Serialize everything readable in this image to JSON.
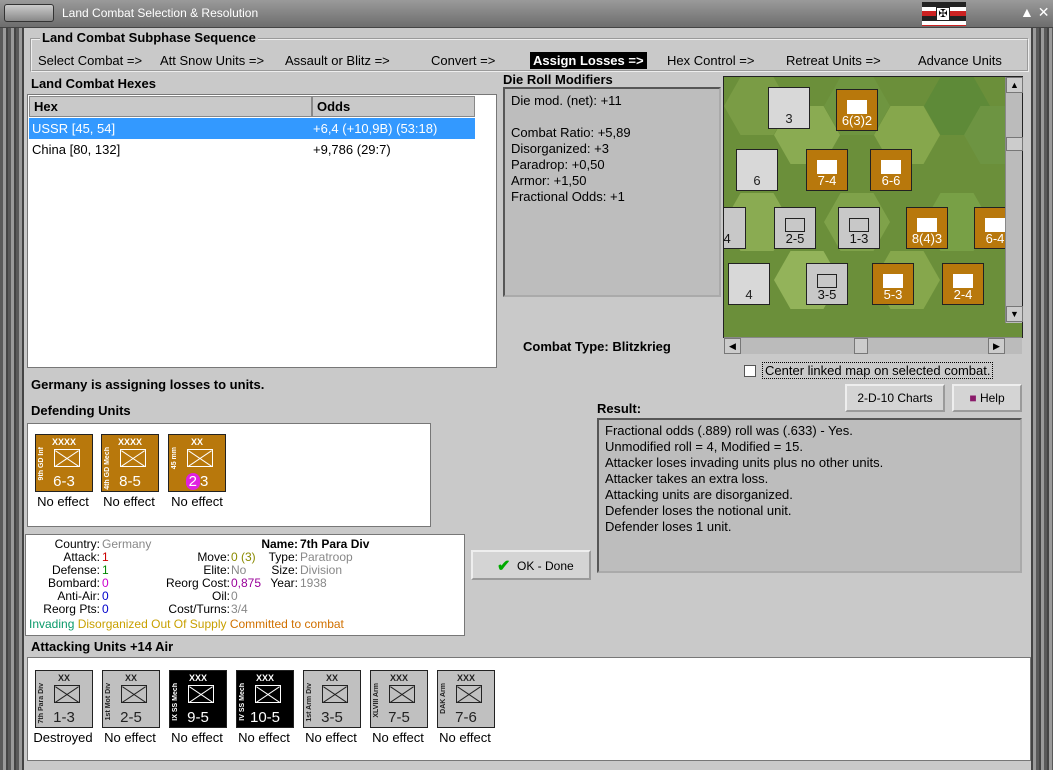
{
  "window": {
    "title": "Land Combat Selection & Resolution",
    "flag_cross": "✠",
    "controls": "▲ ✕"
  },
  "sequence": {
    "title": "Land Combat Subphase Sequence",
    "steps": [
      "Select Combat =>",
      "Att Snow Units =>",
      "Assault or Blitz =>",
      "Convert =>",
      "Assign Losses =>",
      "Hex Control =>",
      "Retreat Units =>",
      "Advance Units"
    ],
    "active_index": 4
  },
  "hexes": {
    "title": "Land Combat Hexes",
    "columns": [
      "Hex",
      "Odds"
    ],
    "rows": [
      {
        "hex": "USSR [45, 54]",
        "odds": "+6,4 (+10,9B) (53:18)",
        "selected": true
      },
      {
        "hex": "China [80, 132]",
        "odds": "+9,786 (29:7)",
        "selected": false
      }
    ]
  },
  "modifiers": {
    "title": "Die Roll Modifiers",
    "lines": [
      "Die mod. (net): +11",
      "",
      "Combat Ratio: +5,89",
      "Disorganized: +3",
      "Paradrop: +0,50",
      "Armor: +1,50",
      "Fractional Odds: +1"
    ]
  },
  "combat_type": {
    "label": "Combat Type:",
    "value": "Blitzkrieg"
  },
  "map": {
    "counters": [
      {
        "name": "Ju 87B",
        "value": "3",
        "kind": "air"
      },
      {
        "name": "Bf 110E",
        "value": "6",
        "kind": "air"
      },
      {
        "name": "G.50",
        "value": "4",
        "kind": "air"
      },
      {
        "name": "inf",
        "value": "6(3)2",
        "kind": "brn"
      },
      {
        "name": "inf",
        "value": "7-4",
        "kind": "brn"
      },
      {
        "name": "inf",
        "value": "6-6",
        "kind": "brn"
      },
      {
        "name": "mot",
        "value": "2-5",
        "kind": "gry"
      },
      {
        "name": "para",
        "value": "1-3",
        "kind": "gry"
      },
      {
        "name": "inf",
        "value": "8(4)3",
        "kind": "brn"
      },
      {
        "name": "inf",
        "value": "6-4",
        "kind": "brn"
      },
      {
        "name": "arm",
        "value": "3-5",
        "kind": "gry"
      },
      {
        "name": "inf",
        "value": "5-3",
        "kind": "brn"
      },
      {
        "name": "cav",
        "value": "2-4",
        "kind": "brn"
      },
      {
        "name": "edge",
        "value": ")4",
        "kind": "gry"
      }
    ]
  },
  "center_map": {
    "label": "Center linked map on selected combat."
  },
  "status": "Germany is assigning losses to units.",
  "buttons": {
    "charts": "2-D-10 Charts",
    "help": "Help",
    "ok": "OK - Done"
  },
  "defending": {
    "title": "Defending Units",
    "units": [
      {
        "size": "XXXX",
        "side": "9th GD Inf",
        "value": "6-3",
        "effect": "No effect",
        "style": "brn"
      },
      {
        "size": "XXXX",
        "side": "4th GD Mech",
        "value": "8-5",
        "effect": "No effect",
        "style": "brn"
      },
      {
        "size": "XX",
        "side": "45 mm",
        "value": "3",
        "badge": "2",
        "effect": "No effect",
        "style": "brn"
      }
    ]
  },
  "unit_info": {
    "labels": {
      "country": "Country:",
      "attack": "Attack:",
      "defense": "Defense:",
      "bombard": "Bombard:",
      "antiair": "Anti-Air:",
      "reorg_pts": "Reorg Pts:",
      "name": "Name:",
      "move": "Move:",
      "type": "Type:",
      "elite": "Elite:",
      "size": "Size:",
      "reorg_cost": "Reorg Cost:",
      "year": "Year:",
      "oil": "Oil:",
      "cost_turns": "Cost/Turns:"
    },
    "country": "Germany",
    "attack": "1",
    "defense": "1",
    "bombard": "0",
    "antiair": "0",
    "reorg_pts": "0",
    "name": "7th Para Div",
    "move": "0 (3)",
    "type": "Paratroop",
    "elite": "No",
    "size": "Division",
    "reorg_cost": "0,875",
    "year": "1938",
    "oil": "0",
    "cost_turns": "3/4",
    "flags": [
      "Invading",
      "Disorganized",
      "Out Of Supply",
      "Committed to combat"
    ],
    "flag_colors": [
      "#0a9a6a",
      "#c8a000",
      "#c8a000",
      "#d07000"
    ]
  },
  "result": {
    "title": "Result:",
    "lines": [
      "Fractional odds (.889) roll was (.633)  - Yes.",
      "Unmodified roll = 4, Modified = 15.",
      "Attacker loses invading units plus no other units.",
      "Attacker takes an extra loss.",
      "Attacking units are disorganized.",
      "Defender loses the notional unit.",
      "Defender loses 1 unit."
    ]
  },
  "attacking": {
    "title": "Attacking Units +14 Air",
    "units": [
      {
        "size": "XX",
        "side": "7th Para Div",
        "value": "1-3",
        "effect": "Destroyed",
        "style": "gry"
      },
      {
        "size": "XX",
        "side": "1st Mot Div",
        "value": "2-5",
        "effect": "No effect",
        "style": "gry"
      },
      {
        "size": "XXX",
        "side": "IX SS Mech",
        "value": "9-5",
        "effect": "No effect",
        "style": "blk"
      },
      {
        "size": "XXX",
        "side": "IV SS Mech",
        "value": "10-5",
        "effect": "No effect",
        "style": "blk"
      },
      {
        "size": "XX",
        "side": "1st Arm Div",
        "value": "3-5",
        "effect": "No effect",
        "style": "gry"
      },
      {
        "size": "XXX",
        "side": "XLVIII Arm",
        "value": "7-5",
        "effect": "No effect",
        "style": "gry"
      },
      {
        "size": "XXX",
        "side": "DAK Arm",
        "value": "7-6",
        "effect": "No effect",
        "style": "gry"
      }
    ]
  }
}
